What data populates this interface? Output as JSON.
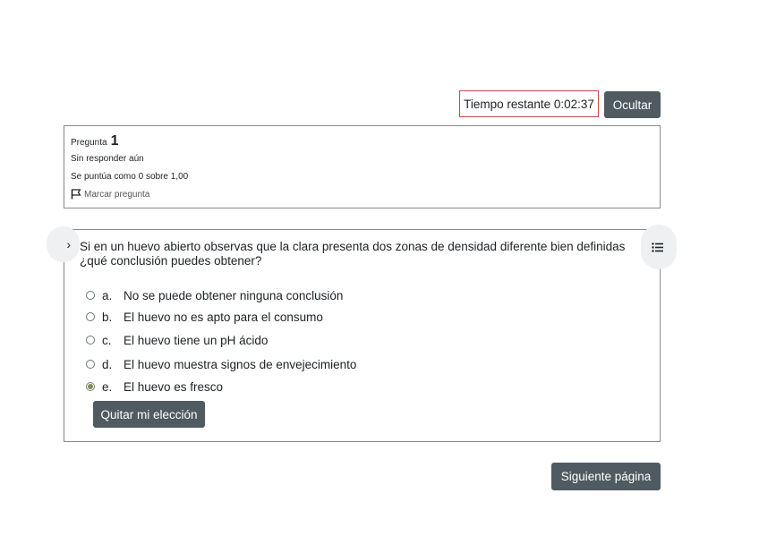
{
  "timer": {
    "label": "Tiempo restante 0:02:37"
  },
  "hide_button": {
    "label": "Ocultar"
  },
  "question_info": {
    "question_prefix": "Pregunta",
    "question_number": "1",
    "state": "Sin responder aún",
    "grade": "Se puntúa como 0 sobre 1,00",
    "flag_label": "Marcar pregunta"
  },
  "question": {
    "text": "Si en un huevo abierto observas que la clara presenta dos zonas de densidad diferente bien definidas ¿qué conclusión puedes obtener?",
    "answers": [
      {
        "letter": "a.",
        "text": "No se puede obtener ninguna conclusión",
        "selected": false
      },
      {
        "letter": "b.",
        "text": "El huevo no es apto para el consumo",
        "selected": false
      },
      {
        "letter": "c.",
        "text": "El huevo tiene un pH ácido",
        "selected": false
      },
      {
        "letter": "d.",
        "text": "El huevo muestra signos de envejecimiento",
        "selected": false
      },
      {
        "letter": "e.",
        "text": "El huevo es fresco",
        "selected": true
      }
    ],
    "clear_button": "Quitar mi elección"
  },
  "next_button": {
    "label": "Siguiente página"
  },
  "colors": {
    "button_bg": "#4f5b61",
    "timer_border": "#c44a4a",
    "radio_selected": "#7b8a5e"
  }
}
